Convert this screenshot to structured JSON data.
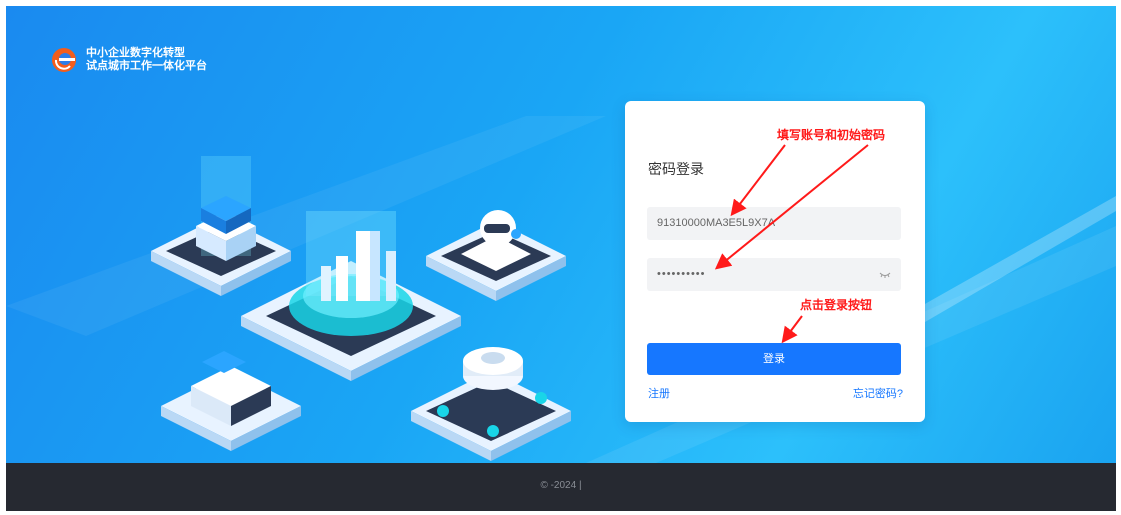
{
  "brand": {
    "line1": "中小企业数字化转型",
    "line2": "试点城市工作一体化平台",
    "logo_icon": "e-logo-icon"
  },
  "login": {
    "title": "密码登录",
    "username_value": "91310000MA3E5L9X7A",
    "password_value": "••••••••••",
    "login_label": "登录",
    "register_label": "注册",
    "forgot_label": "忘记密码?"
  },
  "annotations": {
    "fill_account": "填写账号和初始密码",
    "click_login": "点击登录按钮"
  },
  "footer": {
    "copyright": "© -2024 |"
  },
  "colors": {
    "primary": "#1677ff",
    "annotation": "#ff1a1a",
    "footer_bg": "#262931",
    "hero_bg": "#1aa6f5"
  }
}
